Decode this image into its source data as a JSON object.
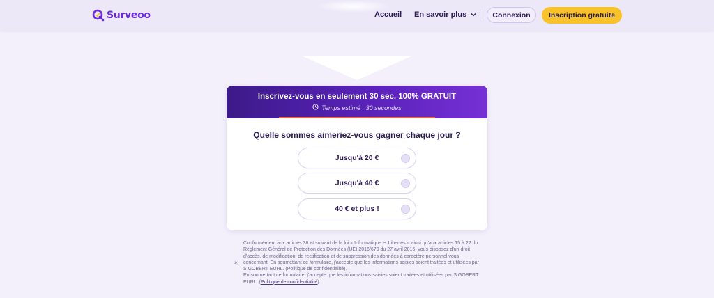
{
  "header": {
    "logo_text": "Surveoo",
    "nav_home": "Accueil",
    "nav_more": "En savoir plus",
    "login_label": "Connexion",
    "signup_label": "Inscription gratuite"
  },
  "card": {
    "title": "Inscrivez-vous en seulement 30 sec. 100% GRATUIT",
    "subtitle": "Temps estimé : 30 secondes",
    "question": "Quelle sommes aimeriez-vous gagner chaque jour ?",
    "options": [
      {
        "label": "Jusqu'à 20 €"
      },
      {
        "label": "Jusqu'à 40 €"
      },
      {
        "label": "40 € et plus !"
      }
    ]
  },
  "legal": {
    "icon": "¾",
    "paragraph1": "Conformément aux articles 38 et suivant de la loi « Informatique et Libertés » ainsi qu'aux articles 15 à 22 du Règlement Général de Protection des Données (UE) 2016/679 du 27 avril 2016, vous disposez d'un droit d'accès, de modification, de rectification et de suppression des données à caractère personnel vous concernant. En soumettant ce formulaire, j'accepte que les informations saisies soient traitées et utilisées par S GOBERT EURL. (Politique de confidentialité).",
    "paragraph2_prefix": "En soumettant ce formulaire, j'accepte que les informations saisies soient traitées et utilisées par S GOBERT EURL. (",
    "privacy_link": "Politique de confidentialité",
    "paragraph2_suffix": ")."
  },
  "colors": {
    "brand_purple": "#6a2bd9",
    "header_gradient_start": "#3c1a88",
    "header_gradient_end": "#7530d4",
    "cta_yellow": "#f7c22a",
    "progress_orange": "#f0682d"
  }
}
